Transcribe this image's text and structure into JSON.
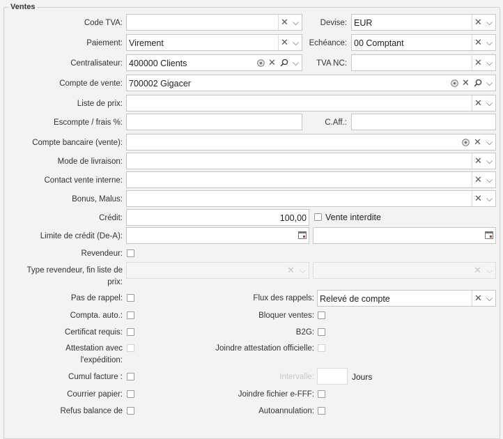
{
  "section": {
    "legend": "Ventes"
  },
  "labels": {
    "code_tva": "Code TVA:",
    "devise": "Devise:",
    "paiement": "Paiement:",
    "echeance": "Echéance:",
    "centralisateur": "Centralisateur:",
    "tva_nc": "TVA NC:",
    "compte_vente": "Compte de vente:",
    "liste_prix": "Liste de prix:",
    "escompte": "Escompte / frais %:",
    "caff": "C.Aff.:",
    "compte_bancaire": "Compte bancaire (vente):",
    "mode_livraison": "Mode de livraison:",
    "contact_vente": "Contact vente interne:",
    "bonus_malus": "Bonus, Malus:",
    "credit": "Crédit:",
    "vente_interdite": "Vente interdite",
    "limite_credit": "Limite de crédit (De-A):",
    "revendeur": "Revendeur:",
    "type_revendeur_1": "Type revendeur, fin liste de",
    "type_revendeur_2": "prix:",
    "pas_rappel": "Pas de rappel:",
    "flux_rappels": "Flux des rappels:",
    "compta_auto": "Compta. auto.:",
    "bloquer_ventes": "Bloquer ventes:",
    "certificat": "Certificat requis:",
    "b2g": "B2G:",
    "attestation_1": "Attestation avec",
    "attestation_2": "l'expédition:",
    "joindre_attestation": "Joindre attestation officielle:",
    "cumul_facture": "Cumul facture :",
    "intervalle": "Intervalle:",
    "jours": "Jours",
    "courrier_papier": "Courrier papier:",
    "joindre_fichier": "Joindre fichier e-FFF:",
    "refus_balance": "Refus balance de",
    "autoannulation": "Autoannulation:"
  },
  "values": {
    "code_tva": "",
    "devise": "EUR",
    "paiement": "Virement",
    "echeance": "00 Comptant",
    "centralisateur": "400000 Clients",
    "tva_nc": "",
    "compte_vente": "700002 Gigacer",
    "liste_prix": "",
    "escompte": "",
    "caff": "",
    "compte_bancaire": "",
    "mode_livraison": "",
    "contact_vente": "",
    "bonus_malus": "",
    "credit": "100,00",
    "limite_credit_de": "",
    "limite_credit_a": "",
    "flux_rappels": "Relevé de compte",
    "intervalle": ""
  },
  "icons": {
    "clear": "✕",
    "dropdown": "⌵",
    "search": "⚲"
  }
}
